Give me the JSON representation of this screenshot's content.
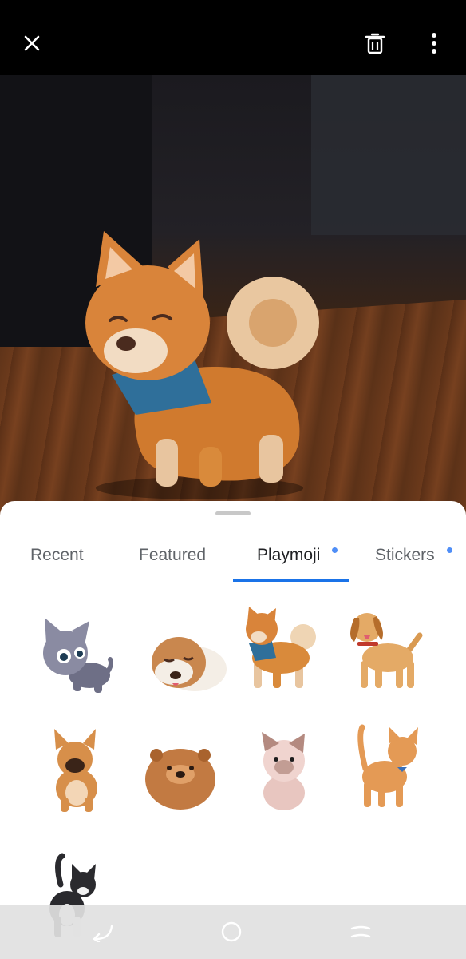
{
  "topbar": {
    "close_icon": "close-icon",
    "delete_icon": "trash-icon",
    "more_icon": "more-vertical-icon"
  },
  "tabs": [
    {
      "label": "Recent",
      "active": false,
      "has_dot": false
    },
    {
      "label": "Featured",
      "active": false,
      "has_dot": false
    },
    {
      "label": "Playmoji",
      "active": true,
      "has_dot": true
    },
    {
      "label": "Stickers",
      "active": false,
      "has_dot": true
    }
  ],
  "playmoji": [
    {
      "name": "gray-kitten"
    },
    {
      "name": "sleeping-bulldog"
    },
    {
      "name": "shiba-inu-bandana"
    },
    {
      "name": "golden-dog"
    },
    {
      "name": "french-bulldog"
    },
    {
      "name": "fluffy-chow"
    },
    {
      "name": "siamese-kitten"
    },
    {
      "name": "orange-tabby-cat"
    },
    {
      "name": "tuxedo-cat"
    }
  ],
  "navbar": {
    "back_icon": "back-icon",
    "home_icon": "home-icon",
    "recents_icon": "recents-icon"
  },
  "colors": {
    "accent": "#1a73e8",
    "dot": "#4f8ef7"
  }
}
